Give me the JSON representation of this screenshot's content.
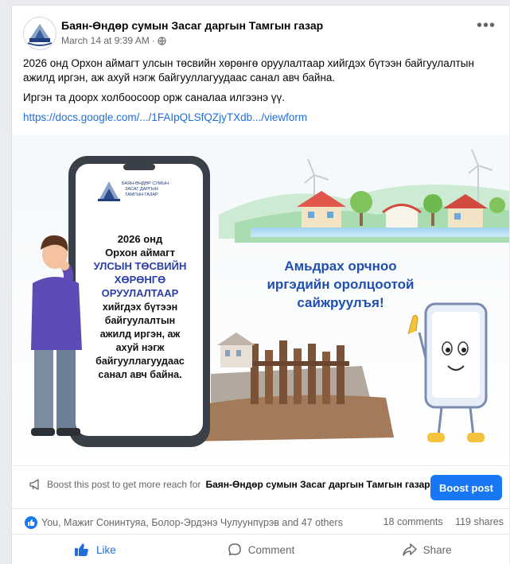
{
  "post": {
    "page_name": "Баян-Өндөр сумын Засаг даргын Тамгын газар",
    "timestamp": "March 14 at 9:39 AM",
    "meta_separator": "·",
    "text_paragraph_1": "2026 онд Орхон аймагт улсын төсвийн хөрөнгө оруулалтаар хийгдэх бүтээн байгуулалтын ажилд иргэн, аж ахуй нэгж байгууллагуудаас санал авч байна.",
    "text_paragraph_2": "Иргэн та доорх холбоосоор орж саналаа илгээнэ үү.",
    "link": "https://docs.google.com/.../1FAIpQLSfQZjyTXdb.../viewform"
  },
  "image": {
    "logo_text_1": "БАЯН-ӨНДӨР СУМЫН",
    "logo_text_2": "ЗАСАГ ДАРГЫН",
    "logo_text_3": "ТАМГЫН ГАЗАР",
    "phone_line_1": "2026 онд",
    "phone_line_2": "Орхон аймагт",
    "phone_highlight_1": "УЛСЫН ТӨСВИЙН",
    "phone_highlight_2": "ХӨРӨНГӨ",
    "phone_highlight_3": "ОРУУЛАЛТААР",
    "phone_line_3": "хийгдэх бүтээн",
    "phone_line_4": "байгуулалтын",
    "phone_line_5": "ажилд иргэн, аж",
    "phone_line_6": "ахуй нэгж",
    "phone_line_7": "байгууллагуудаас",
    "phone_line_8": "санал авч байна.",
    "slogan_1": "Амьдрах орчноо",
    "slogan_2": "иргэдийн оролцоотой",
    "slogan_3": "сайжруулъя!"
  },
  "boost": {
    "text_prefix": "Boost this post to get more reach for",
    "page_name": "Баян-Өндөр сумын Засаг даргын Тамгын газар.",
    "button_label": "Boost post"
  },
  "reactions": {
    "names": "You, Мажиг Сонинтуяа, Болор-Эрдэнэ Чулуунпүрэв and 47 others",
    "comments": "18 comments",
    "shares": "119 shares"
  },
  "actions": {
    "like": "Like",
    "comment": "Comment",
    "share": "Share"
  },
  "colors": {
    "brand_blue": "#1877f2",
    "link_blue": "#216fdb",
    "phone_highlight": "#2a3ea8",
    "slogan": "#1f4fb0"
  }
}
